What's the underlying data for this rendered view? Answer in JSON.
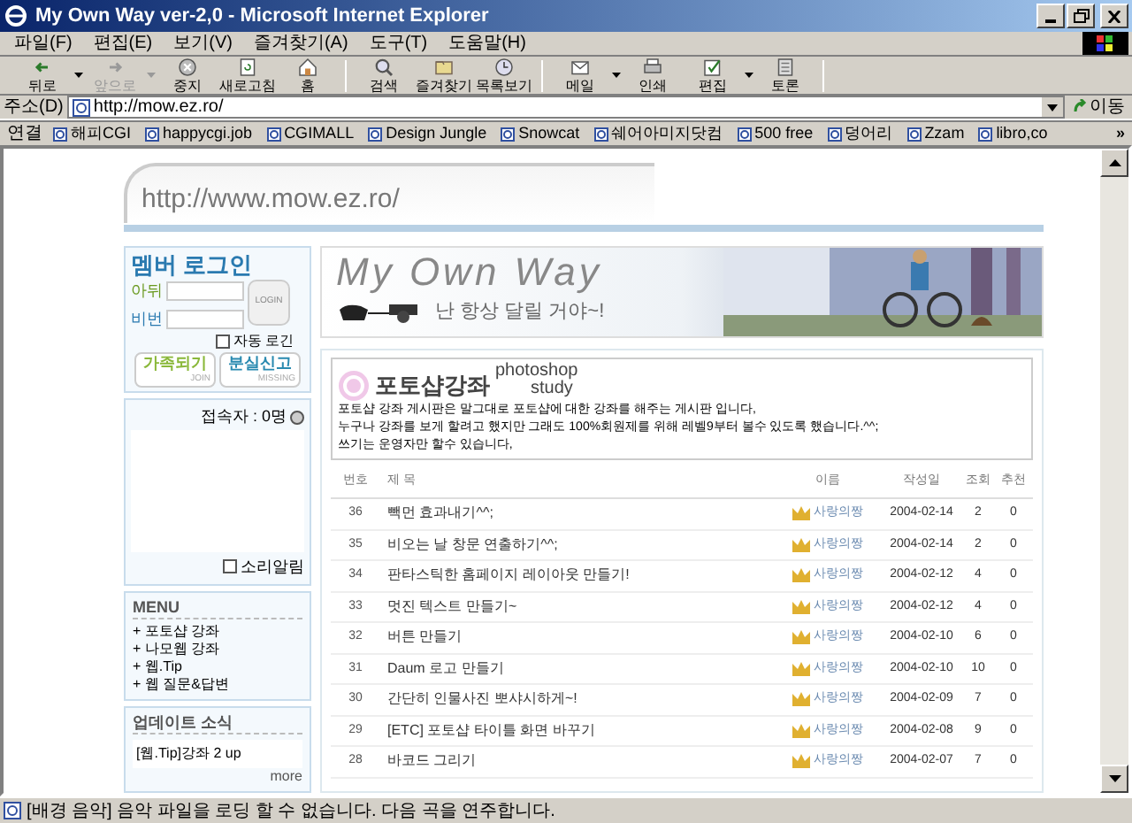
{
  "window": {
    "title": "My Own Way ver-2,0 - Microsoft Internet Explorer"
  },
  "menu": [
    "파일(F)",
    "편집(E)",
    "보기(V)",
    "즐겨찾기(A)",
    "도구(T)",
    "도움말(H)"
  ],
  "toolbar": [
    {
      "kind": "back",
      "label": "뒤로",
      "disabled": false,
      "dropdown": true
    },
    {
      "kind": "forward",
      "label": "앞으로",
      "disabled": true,
      "dropdown": true
    },
    {
      "kind": "stop",
      "label": "중지",
      "disabled": false,
      "dropdown": false
    },
    {
      "kind": "refresh",
      "label": "새로고침",
      "disabled": false,
      "dropdown": false
    },
    {
      "kind": "home",
      "label": "홈",
      "disabled": false,
      "dropdown": false
    },
    {
      "kind": "search",
      "label": "검색",
      "disabled": false,
      "dropdown": false
    },
    {
      "kind": "favorites",
      "label": "즐겨찾기",
      "disabled": false,
      "dropdown": false
    },
    {
      "kind": "history",
      "label": "목록보기",
      "disabled": false,
      "dropdown": false
    },
    {
      "kind": "mail",
      "label": "메일",
      "disabled": false,
      "dropdown": true
    },
    {
      "kind": "print",
      "label": "인쇄",
      "disabled": false,
      "dropdown": false
    },
    {
      "kind": "edit",
      "label": "편집",
      "disabled": false,
      "dropdown": true
    },
    {
      "kind": "discuss",
      "label": "토론",
      "disabled": false,
      "dropdown": false
    }
  ],
  "address": {
    "label": "주소(D)",
    "url": "http://mow.ez.ro/",
    "go": "이동"
  },
  "links": {
    "label": "연결",
    "items": [
      "해피CGI",
      "happycgi.job",
      "CGIMALL",
      "Design Jungle",
      "Snowcat",
      "쉐어아미지닷컴",
      "500 free",
      "덩어리",
      "Zzam",
      "libro,co"
    ],
    "more": "»"
  },
  "page": {
    "site_url": "http://www.mow.ez.ro/",
    "login": {
      "title": "멤버 로그인",
      "id_label": "아뒤",
      "pw_label": "비번",
      "button": "LOGIN",
      "auto_login": {
        "label": "자동 로긴",
        "checked": false
      },
      "buttons": [
        {
          "label": "가족되기",
          "sub": "JOIN"
        },
        {
          "label": "분실신고",
          "sub": "MISSING"
        }
      ]
    },
    "visitors": {
      "count": "접속자 : 0명",
      "sound_alarm": {
        "label": "소리알림",
        "checked": false
      }
    },
    "menu": {
      "title": "MENU",
      "items": [
        "+ 포토샵 강좌",
        "+ 나모웹 강좌",
        "+ 웹.Tip",
        "+ 웹 질문&답변"
      ]
    },
    "updates": {
      "title": "업데이트 소식",
      "items": [
        "[웹.Tip]강좌 2 up"
      ],
      "more": "more"
    },
    "banner": {
      "title": "My Own Way",
      "slogan": "난 항상 달릴 거야~!"
    },
    "board": {
      "title": "포토샵강좌",
      "subtitle": [
        "photoshop",
        "study"
      ],
      "description": [
        "포토샵 강좌 게시판은 말그대로 포토샵에 대한 강좌를 해주는 게시판 입니다,",
        "누구나 강좌를 보게 할려고 했지만 그래도 100%회원제를 위해 레벨9부터 볼수 있도록 했습니다.^^;",
        "쓰기는 운영자만 할수 있습니다,"
      ],
      "columns": [
        "번호",
        "제 목",
        "이름",
        "작성일",
        "조회",
        "추천"
      ],
      "rows": [
        [
          "36",
          "빽먼 효과내기^^;",
          "사랑의짱",
          "2004-02-14",
          "2",
          "0"
        ],
        [
          "35",
          "비오는 날 창문 연출하기^^;",
          "사랑의짱",
          "2004-02-14",
          "2",
          "0"
        ],
        [
          "34",
          "판타스틱한 홈페이지 레이아웃 만들기!",
          "사랑의짱",
          "2004-02-12",
          "4",
          "0"
        ],
        [
          "33",
          "멋진 텍스트 만들기~",
          "사랑의짱",
          "2004-02-12",
          "4",
          "0"
        ],
        [
          "32",
          "버튼 만들기",
          "사랑의짱",
          "2004-02-10",
          "6",
          "0"
        ],
        [
          "31",
          "Daum 로고 만들기",
          "사랑의짱",
          "2004-02-10",
          "10",
          "0"
        ],
        [
          "30",
          "간단히 인물사진 뽀샤시하게~!",
          "사랑의짱",
          "2004-02-09",
          "7",
          "0"
        ],
        [
          "29",
          "[ETC] 포토샵 타이틀 화면 바꾸기",
          "사랑의짱",
          "2004-02-08",
          "9",
          "0"
        ],
        [
          "28",
          "바코드 그리기",
          "사랑의짱",
          "2004-02-07",
          "7",
          "0"
        ]
      ]
    }
  },
  "status_bar": "[배경 음악] 음악 파일을 로딩 할 수 없습니다. 다음 곡을 연주합니다."
}
